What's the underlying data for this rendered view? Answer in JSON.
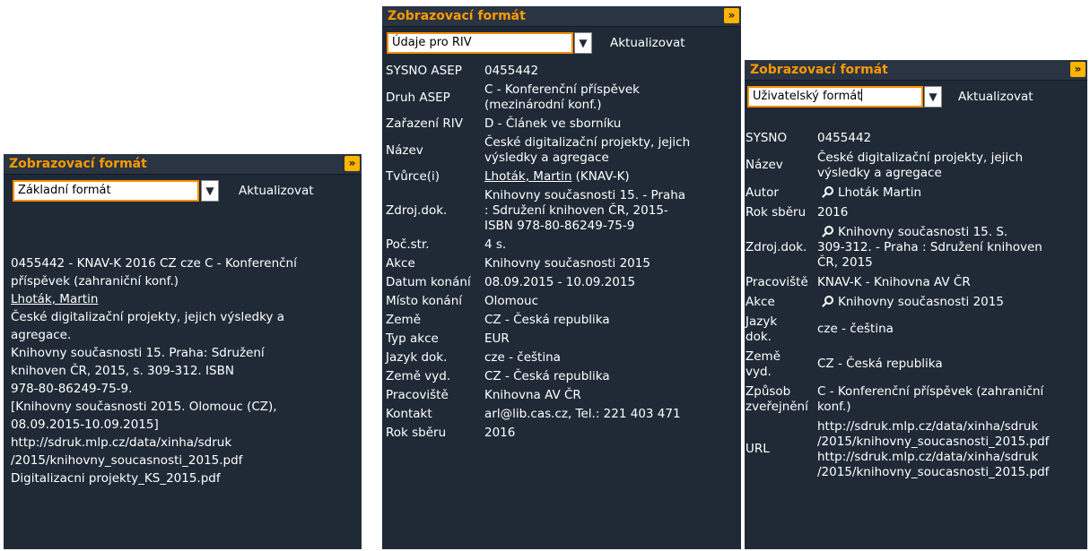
{
  "colors": {
    "panel_bg": "#1f2a36",
    "header_title": "#ff9a00",
    "header_button": "#ffb400",
    "select_border": "#ff8c00",
    "text": "#ffffff"
  },
  "icons": {
    "expand": "double-chevron-right-icon",
    "dropdown": "chevron-down-icon",
    "search": "magnifier-icon"
  },
  "panel1": {
    "header_title": "Zobrazovací formát",
    "header_btn": "»",
    "select_value": "Základní formát",
    "update_label": "Aktualizovat",
    "lines": [
      "0455442 - KNAV-K 2016 CZ cze C - Konferenční",
      "příspěvek (zahraniční konf.)",
      "Lhoták, Martin",
      "České digitalizační projekty, jejich výsledky a",
      "agregace.",
      "Knihovny současnosti 15. Praha: Sdružení",
      "knihoven ČR, 2015, s. 309-312. ISBN",
      "978-80-86249-75-9.",
      "[Knihovny současnosti 2015. Olomouc (CZ),",
      "08.09.2015-10.09.2015]",
      "http://sdruk.mlp.cz/data/xinha/sdruk",
      "/2015/knihovny_soucasnosti_2015.pdf",
      "Digitalizacni projekty_KS_2015.pdf"
    ]
  },
  "panel2": {
    "header_title": "Zobrazovací formát",
    "header_btn": "»",
    "select_value": "Údaje pro RIV",
    "update_label": "Aktualizovat",
    "rows": [
      {
        "k": "SYSNO ASEP",
        "v": [
          "0455442"
        ]
      },
      {
        "k": "Druh ASEP",
        "v": [
          "C - Konferenční příspěvek",
          "(mezinárodní konf.)"
        ]
      },
      {
        "k": "Zařazení RIV",
        "v": [
          "D - Článek ve sborníku"
        ]
      },
      {
        "k": "Název",
        "v": [
          "České digitalizační projekty, jejich",
          "výsledky a agregace"
        ]
      },
      {
        "k": "Tvůrce(i)",
        "v_link": "Lhoták, Martin",
        "v_rest": " (KNAV-K)"
      },
      {
        "k": "Zdroj.dok.",
        "v": [
          "Knihovny současnosti 15. - Praha",
          ": Sdružení knihoven ČR, 2015-",
          "ISBN 978-80-86249-75-9"
        ]
      },
      {
        "k": "Poč.str.",
        "v": [
          "4 s."
        ]
      },
      {
        "k": "Akce",
        "v": [
          "Knihovny současnosti 2015"
        ]
      },
      {
        "k": "Datum konání",
        "v": [
          "08.09.2015 - 10.09.2015"
        ]
      },
      {
        "k": "Místo konání",
        "v": [
          "Olomouc"
        ]
      },
      {
        "k": "Země",
        "v": [
          "CZ - Česká republika"
        ]
      },
      {
        "k": "Typ akce",
        "v": [
          "EUR"
        ]
      },
      {
        "k": "Jazyk dok.",
        "v": [
          "cze - čeština"
        ]
      },
      {
        "k": "Země vyd.",
        "v": [
          "CZ - Česká republika"
        ]
      },
      {
        "k": "Pracoviště",
        "v": [
          "Knihovna AV ČR"
        ]
      },
      {
        "k": "Kontakt",
        "v": [
          "arl@lib.cas.cz, Tel.: 221 403 471"
        ]
      },
      {
        "k": "Rok sběru",
        "v": [
          "2016"
        ]
      }
    ]
  },
  "panel3": {
    "header_title": "Zobrazovací formát",
    "header_btn": "»",
    "select_value": "Uživatelský formát",
    "update_label": "Aktualizovat",
    "rows": [
      {
        "k": [
          "SYSNO"
        ],
        "v": [
          "0455442"
        ]
      },
      {
        "k": [
          "Název"
        ],
        "v": [
          "České digitalizační projekty, jejich",
          "výsledky a agregace"
        ]
      },
      {
        "k": [
          "Autor"
        ],
        "v": [
          "Lhoták Martin"
        ],
        "icon": true
      },
      {
        "k": [
          "Rok sběru"
        ],
        "v": [
          "2016"
        ]
      },
      {
        "k": [
          "Zdroj.dok."
        ],
        "v": [
          "Knihovny současnosti 15. S.",
          "309-312. - Praha : Sdružení knihoven",
          "ČR, 2015"
        ],
        "icon": true
      },
      {
        "k": [
          "Pracoviště"
        ],
        "v": [
          "KNAV-K - Knihovna AV ČR"
        ]
      },
      {
        "k": [
          "Akce"
        ],
        "v": [
          "Knihovny současnosti 2015"
        ],
        "icon": true
      },
      {
        "k": [
          "Jazyk",
          "dok."
        ],
        "v": [
          "cze - čeština"
        ]
      },
      {
        "k": [
          "Země",
          "vyd."
        ],
        "v": [
          "CZ - Česká republika"
        ]
      },
      {
        "k": [
          "Způsob",
          "zveřejnění"
        ],
        "v": [
          "C - Konferenční příspěvek (zahraniční",
          "konf.)"
        ]
      },
      {
        "k": [
          "URL"
        ],
        "v": [
          "http://sdruk.mlp.cz/data/xinha/sdruk",
          "/2015/knihovny_soucasnosti_2015.pdf",
          "http://sdruk.mlp.cz/data/xinha/sdruk",
          "/2015/knihovny_soucasnosti_2015.pdf"
        ]
      }
    ]
  }
}
